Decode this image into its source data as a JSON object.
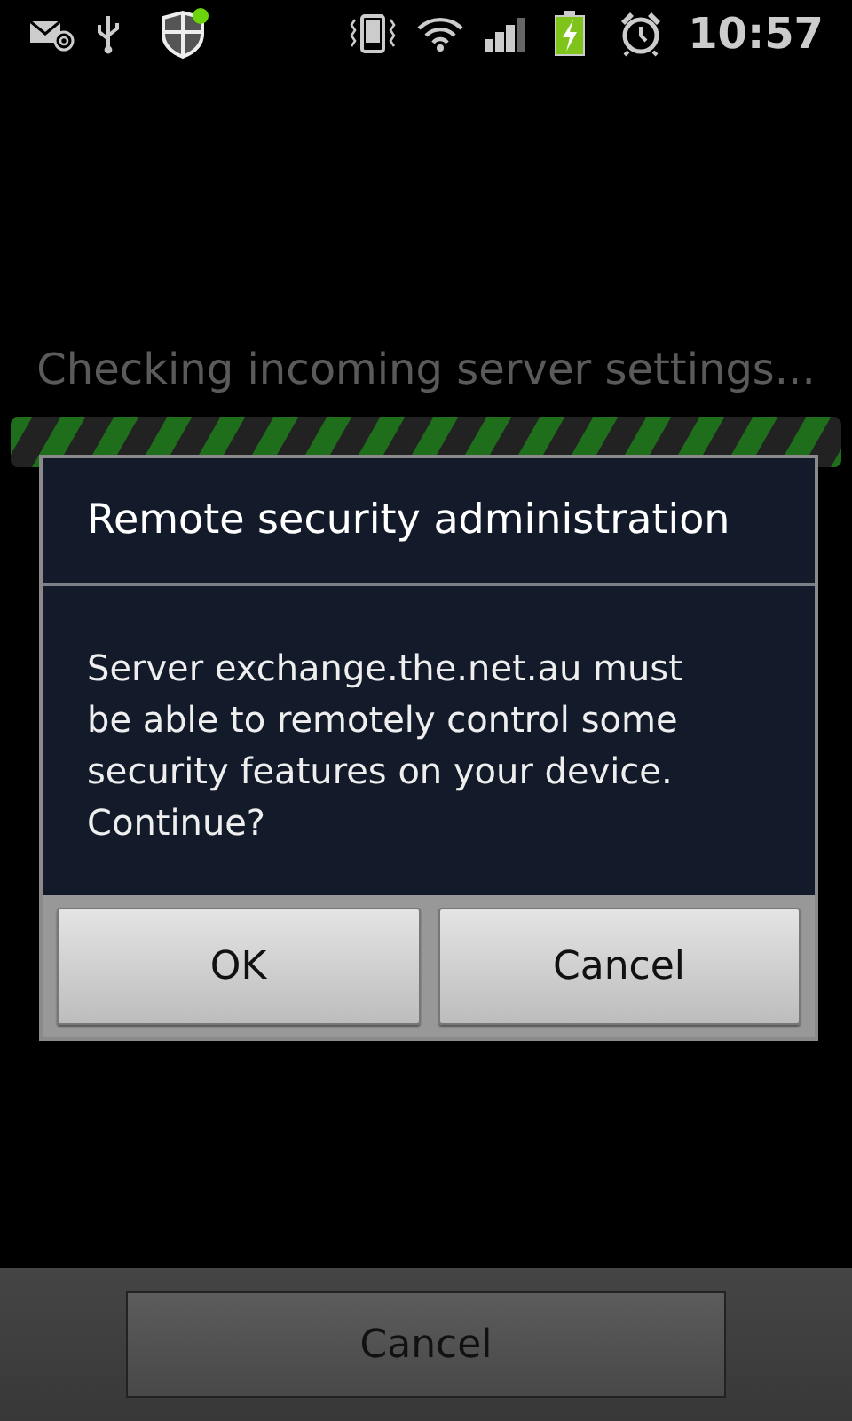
{
  "status_bar": {
    "time": "10:57"
  },
  "progress": {
    "label": "Checking incoming server settings...",
    "indeterminate": true
  },
  "dialog": {
    "title": "Remote security administration",
    "message": "Server exchange.the.net.au must be able to remotely control some security features on your device. Continue?",
    "buttons": [
      "OK",
      "Cancel"
    ]
  },
  "bottom_bar": {
    "button": "Cancel"
  }
}
